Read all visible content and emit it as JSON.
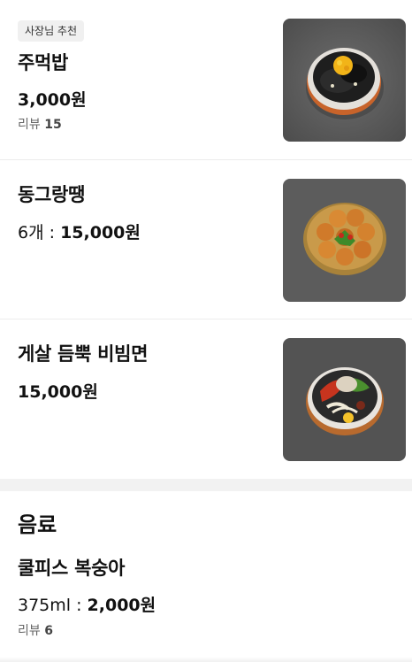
{
  "menu": {
    "items": [
      {
        "badge": "사장님 추천",
        "name": "주먹밥",
        "price_prefix": "",
        "price": "3,000원",
        "review_label": "리뷰",
        "review_count": "15",
        "image_icon": "rice-ball-bowl-photo"
      },
      {
        "name": "동그랑땡",
        "price_prefix": "6개 : ",
        "price": "15,000원",
        "image_icon": "pancake-plate-photo"
      },
      {
        "name": "게살 듬뿍 비빔면",
        "price_prefix": "",
        "price": "15,000원",
        "image_icon": "noodle-bowl-photo"
      }
    ]
  },
  "drinks": {
    "section_title": "음료",
    "items": [
      {
        "name": "쿨피스 복숭아",
        "price_prefix": "375ml : ",
        "price": "2,000원",
        "review_label": "리뷰",
        "review_count": "6"
      }
    ]
  },
  "colors": {
    "divider": "#ececec",
    "section_gap": "#f2f2f2",
    "badge_bg": "#f0f0f0"
  }
}
